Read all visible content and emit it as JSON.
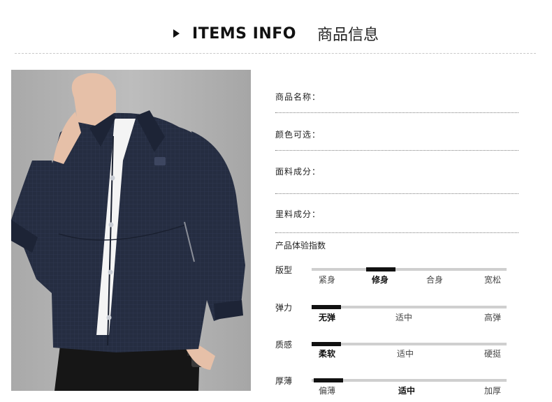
{
  "header": {
    "title_en": "ITEMS INFO",
    "title_zh": "商品信息"
  },
  "fields": [
    {
      "label": "商品名称："
    },
    {
      "label": "颜色可选："
    },
    {
      "label": "面料成分："
    },
    {
      "label": "里料成分："
    }
  ],
  "experience": {
    "title": "产品体验指数",
    "metrics": [
      {
        "label": "版型",
        "options": [
          "紧身",
          "修身",
          "合身",
          "宽松"
        ],
        "selected_index": 1
      },
      {
        "label": "弹力",
        "options": [
          "无弹",
          "适中",
          "高弹"
        ],
        "selected_index": 0
      },
      {
        "label": "质感",
        "options": [
          "柔软",
          "适中",
          "硬挺"
        ],
        "selected_index": 0
      },
      {
        "label": "厚薄",
        "options": [
          "偏薄",
          "适中",
          "加厚"
        ],
        "selected_index": 1
      }
    ]
  },
  "colors": {
    "jacket": "#252d41",
    "background_photo": "#b5b5b5",
    "marker": "#111111",
    "track": "#cfcfcf"
  }
}
